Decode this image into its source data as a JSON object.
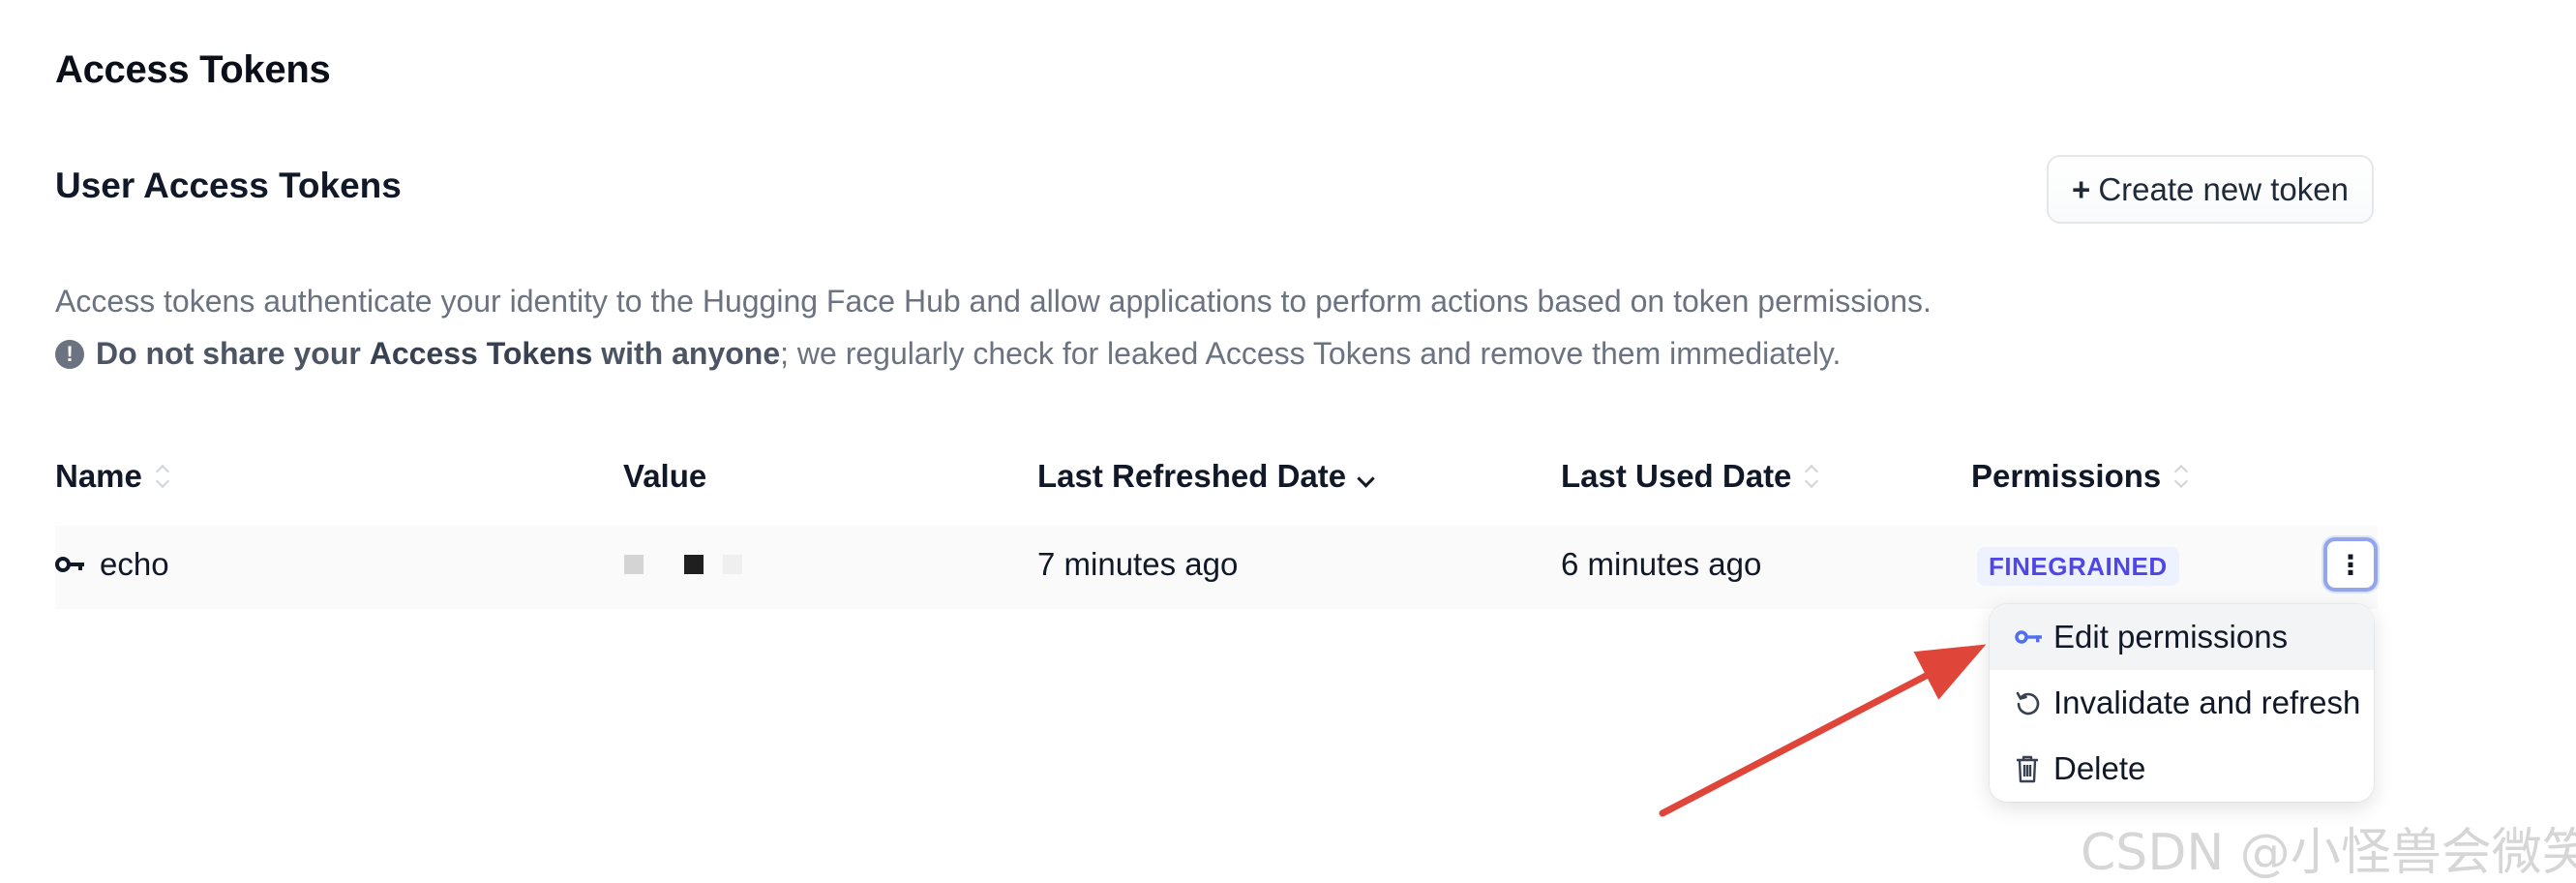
{
  "page": {
    "title": "Access Tokens"
  },
  "section": {
    "title": "User Access Tokens",
    "create_button": {
      "plus": "+",
      "label": "Create new token"
    },
    "description": "Access tokens authenticate your identity to the Hugging Face Hub and allow applications to perform actions based on token permissions.",
    "warning": {
      "icon": "!",
      "bold_1": "Do not share your",
      "bold_2": "Access Tokens",
      "bold_3": "with anyone",
      "rest": "; we regularly check for leaked Access Tokens and remove them immediately."
    }
  },
  "table": {
    "headers": {
      "name": "Name",
      "value": "Value",
      "last_refreshed": "Last Refreshed Date",
      "last_used": "Last Used Date",
      "permissions": "Permissions"
    },
    "rows": [
      {
        "name": "echo",
        "last_refreshed": "7 minutes ago",
        "last_used": "6 minutes ago",
        "permission": "FINEGRAINED",
        "kebab": "⋮"
      }
    ]
  },
  "menu": {
    "items": [
      {
        "label": "Edit permissions",
        "icon": "key-icon"
      },
      {
        "label": "Invalidate and refresh",
        "icon": "refresh-icon"
      },
      {
        "label": "Delete",
        "icon": "trash-icon"
      }
    ]
  },
  "annotation": {
    "arrow_color": "#e0453a"
  },
  "watermark": "CSDN @小怪兽会微笑",
  "colors": {
    "accent": "#4f46e5",
    "badge_bg": "#eef2ff",
    "text_muted": "#6b7280"
  }
}
